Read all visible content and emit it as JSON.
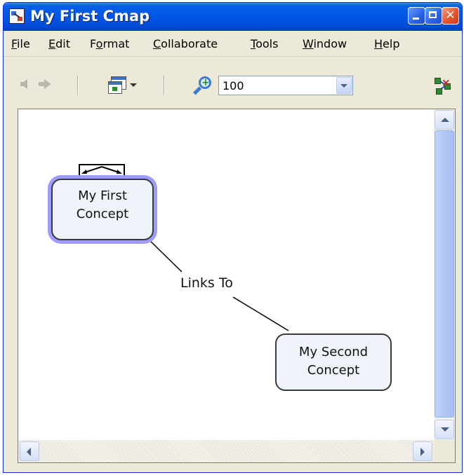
{
  "window": {
    "title": "My First Cmap",
    "close_glyph": "✕"
  },
  "menu": {
    "items": [
      {
        "pre": "",
        "key": "F",
        "post": "ile"
      },
      {
        "pre": "",
        "key": "E",
        "post": "dit"
      },
      {
        "pre": "F",
        "key": "o",
        "post": "rmat"
      },
      {
        "pre": "",
        "key": "C",
        "post": "ollaborate"
      },
      {
        "pre": "",
        "key": "T",
        "post": "ools"
      },
      {
        "pre": "",
        "key": "W",
        "post": "indow"
      },
      {
        "pre": "",
        "key": "H",
        "post": "elp"
      }
    ]
  },
  "toolbar": {
    "zoom_value": "100"
  },
  "cmap": {
    "concept1": {
      "line1": "My First",
      "line2": "Concept"
    },
    "concept2": {
      "line1": "My Second",
      "line2": "Concept"
    },
    "link_label": "Links To",
    "selection_color": "#9f9cff",
    "concept_fill": "#eef4f9"
  },
  "colors": {
    "titlebar": "#0055e5",
    "chrome": "#ece9d8"
  }
}
